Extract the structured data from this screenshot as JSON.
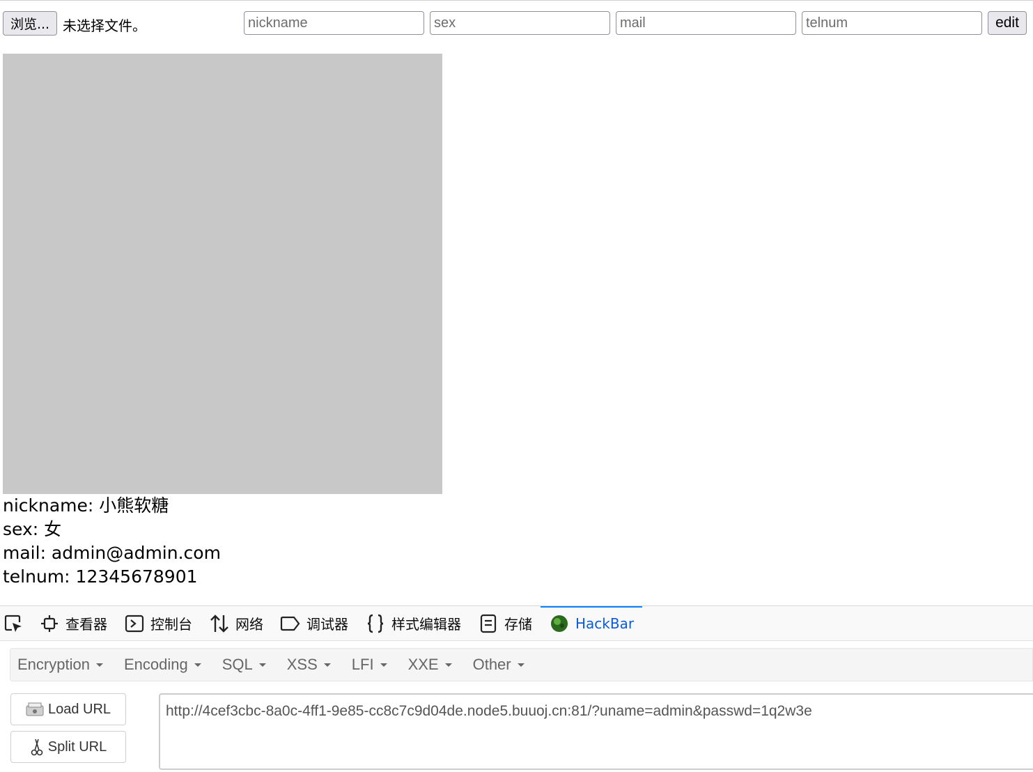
{
  "form": {
    "browse_label": "浏览...",
    "file_status": "未选择文件。",
    "nickname_placeholder": "nickname",
    "sex_placeholder": "sex",
    "mail_placeholder": "mail",
    "telnum_placeholder": "telnum",
    "edit_label": "edit"
  },
  "profile": {
    "nickname": "nickname: 小熊软糖",
    "sex": "sex: 女",
    "mail": "mail: admin@admin.com",
    "telnum": "telnum: 12345678901"
  },
  "devtools": {
    "tabs": [
      {
        "label": "查看器",
        "icon": "inspector-icon"
      },
      {
        "label": "控制台",
        "icon": "console-icon"
      },
      {
        "label": "网络",
        "icon": "network-arrows-icon"
      },
      {
        "label": "调试器",
        "icon": "debugger-icon"
      },
      {
        "label": "样式编辑器",
        "icon": "braces-icon"
      },
      {
        "label": "存储",
        "icon": "storage-icon"
      },
      {
        "label": "HackBar",
        "icon": "hackbar-logo-icon",
        "active": true
      }
    ],
    "accent_color": "#0a84ff"
  },
  "hackbar": {
    "menu": [
      "Encryption",
      "Encoding",
      "SQL",
      "XSS",
      "LFI",
      "XXE",
      "Other"
    ],
    "load_url_label": "Load URL",
    "split_url_label": "Split URL",
    "url_value": "http://4cef3cbc-8a0c-4ff1-9e85-cc8c7c9d04de.node5.buuoj.cn:81/?uname=admin&passwd=1q2w3e"
  }
}
